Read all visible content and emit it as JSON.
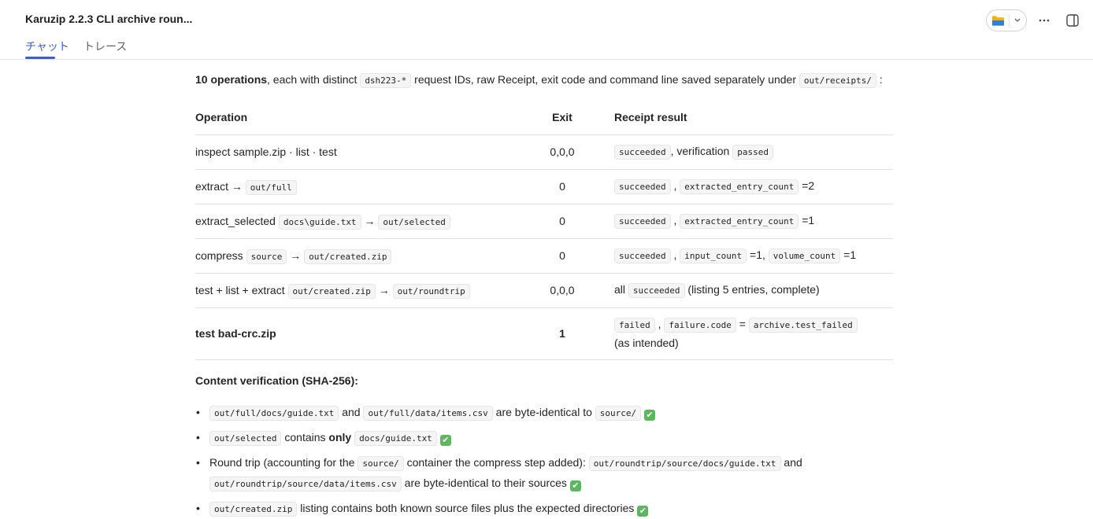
{
  "header": {
    "title": "Karuzip 2.2.3 CLI archive roun...",
    "tabs": [
      {
        "label": "チャット",
        "active": true
      },
      {
        "label": "トレース",
        "active": false
      }
    ],
    "folder_icon": "folder-icon",
    "accent": "#3c5bd6"
  },
  "intro": {
    "count_bold": "10 operations",
    "text1": ", each with distinct ",
    "code1": "dsh223-*",
    "text2": " request IDs, raw Receipt, exit code and command line saved separately under ",
    "code2": "out/receipts/",
    "text3": " :"
  },
  "table": {
    "headers": [
      "Operation",
      "Exit",
      "Receipt result"
    ],
    "rows": [
      {
        "op": [
          {
            "t": "inspect sample.zip · list · test"
          }
        ],
        "exit": "0,0,0",
        "res": [
          {
            "c": "succeeded"
          },
          {
            "t": ", verification "
          },
          {
            "c": "passed"
          }
        ]
      },
      {
        "op": [
          {
            "t": "extract → "
          },
          {
            "c": "out/full"
          }
        ],
        "exit": "0",
        "res": [
          {
            "c": "succeeded"
          },
          {
            "t": " , "
          },
          {
            "c": "extracted_entry_count"
          },
          {
            "t": " =2"
          }
        ]
      },
      {
        "op": [
          {
            "t": "extract_selected "
          },
          {
            "c": "docs\\guide.txt"
          },
          {
            "t": " → "
          },
          {
            "c": "out/selected"
          }
        ],
        "exit": "0",
        "res": [
          {
            "c": "succeeded"
          },
          {
            "t": " , "
          },
          {
            "c": "extracted_entry_count"
          },
          {
            "t": " =1"
          }
        ]
      },
      {
        "op": [
          {
            "t": "compress "
          },
          {
            "c": "source"
          },
          {
            "t": " → "
          },
          {
            "c": "out/created.zip"
          }
        ],
        "exit": "0",
        "res": [
          {
            "c": "succeeded"
          },
          {
            "t": " , "
          },
          {
            "c": "input_count"
          },
          {
            "t": " =1, "
          },
          {
            "c": "volume_count"
          },
          {
            "t": " =1"
          }
        ]
      },
      {
        "op": [
          {
            "t": "test + list + extract "
          },
          {
            "c": "out/created.zip"
          },
          {
            "t": " → "
          },
          {
            "c": "out/roundtrip"
          }
        ],
        "exit": "0,0,0",
        "res": [
          {
            "t": "all "
          },
          {
            "c": "succeeded"
          },
          {
            "t": " (listing 5 entries, complete)"
          }
        ]
      },
      {
        "op": [
          {
            "b": "test bad-crc.zip"
          }
        ],
        "exit": "1",
        "exit_bold": true,
        "tall": true,
        "res": [
          {
            "c": "failed"
          },
          {
            "t": " , "
          },
          {
            "c": "failure.code"
          },
          {
            "t": " = "
          },
          {
            "c": "archive.test_failed"
          },
          {
            "t": " (as intended)"
          }
        ]
      }
    ]
  },
  "verification": {
    "title": "Content verification (SHA-256):",
    "items": [
      [
        {
          "c": "out/full/docs/guide.txt"
        },
        {
          "t": " and "
        },
        {
          "c": "out/full/data/items.csv"
        },
        {
          "t": " are byte-identical to "
        },
        {
          "c": "source/"
        },
        {
          "k": "✔"
        }
      ],
      [
        {
          "c": "out/selected"
        },
        {
          "t": " contains "
        },
        {
          "b": "only"
        },
        {
          "t": " "
        },
        {
          "c": "docs/guide.txt"
        },
        {
          "k": "✔"
        }
      ],
      [
        {
          "t": "Round trip (accounting for the "
        },
        {
          "c": "source/"
        },
        {
          "t": " container the compress step added): "
        },
        {
          "c": "out/roundtrip/source/docs/guide.txt"
        },
        {
          "t": " and "
        },
        {
          "c": "out/roundtrip/source/data/items.csv"
        },
        {
          "t": " are byte-identical to their sources"
        },
        {
          "k": "✔"
        }
      ],
      [
        {
          "c": "out/created.zip"
        },
        {
          "t": " listing contains both known source files plus the expected directories"
        },
        {
          "k": "✔"
        }
      ]
    ],
    "check_icon": "check-mark-icon",
    "check_color": "#5cb85c"
  }
}
